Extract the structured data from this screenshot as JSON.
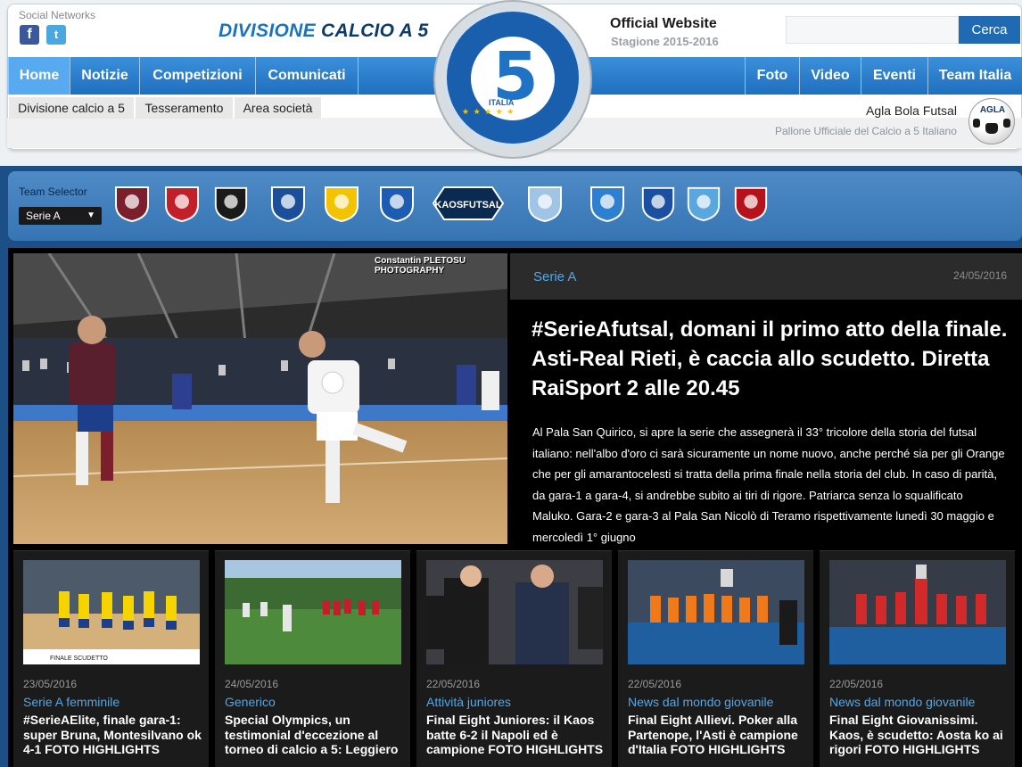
{
  "header": {
    "social_label": "Social Networks",
    "title_accent": "DIVISIONE",
    "title_rest": " CALCIO A 5",
    "official": "Official Website",
    "season": "Stagione 2015-2016",
    "search_placeholder": "",
    "search_button": "Cerca",
    "logo_text": "ITALIA",
    "logo_stars": "★ ★ ★ ★ ★",
    "logo_digit": "5",
    "sponsor_name": "Agla Bola Futsal",
    "sponsor_sub": "Pallone Ufficiale del Calcio a 5 Italiano",
    "sponsor_badge": "AGLA"
  },
  "social": {
    "facebook": "f",
    "twitter": "t"
  },
  "nav": {
    "left": [
      "Home",
      "Notizie",
      "Competizioni",
      "Comunicati"
    ],
    "right": [
      "Foto",
      "Video",
      "Eventi",
      "Team Italia"
    ],
    "active": "Home"
  },
  "subnav": [
    "Divisione calcio a 5",
    "Tesseramento",
    "Area società"
  ],
  "team_selector": {
    "label": "Team Selector",
    "selected": "Serie A",
    "kaos_label": "KAOSFUTSAL",
    "crest_colors": [
      "#7a1f2b",
      "#c21f2a",
      "#1a1a1a",
      "#1b4f9a",
      "#f2c300",
      "#1d5cb0",
      "#0b2a52",
      "#9fc4e6",
      "#2d7fd0",
      "#1b4fa0",
      "#5aa6df",
      "#b5121b"
    ]
  },
  "hero": {
    "photo_credit": "Constantin PLETOSU PHOTOGRAPHY",
    "category": "Serie A",
    "date": "24/05/2016",
    "title": "#SerieAfutsal, domani il primo atto della finale. Asti-Real Rieti, è caccia allo scudetto. Diretta RaiSport 2 alle 20.45",
    "text": "Al Pala San Quirico, si apre la serie che assegnerà il 33° tricolore della storia del futsal italiano: nell'albo d'oro ci sarà sicuramente un nome nuovo, anche perché sia per gli Orange che per gli amarantocelesti si tratta della prima finale nella storia del club. In caso di parità, da gara-1 a gara-4, si andrebbe subito ai tiri di rigore. Patriarca senza lo squalificato Maluko. Gara-2 e gara-3 al Pala San Nicolò di Teramo rispettivamente lunedì 30 maggio e mercoledì 1° giugno"
  },
  "cards": [
    {
      "date": "23/05/2016",
      "category": "Serie A femminile",
      "title": "#SerieAElite, finale gara-1: super Bruna, Montesilvano ok 4-1 FOTO HIGHLIGHTS",
      "banner": "FINALE SCUDETTO"
    },
    {
      "date": "24/05/2016",
      "category": "Generico",
      "title": "Special Olympics, un testimonial d'eccezione al torneo di calcio a 5: Leggiero"
    },
    {
      "date": "22/05/2016",
      "category": "Attività juniores",
      "title": "Final Eight Juniores: il Kaos batte 6-2 il Napoli ed è campione FOTO HIGHLIGHTS"
    },
    {
      "date": "22/05/2016",
      "category": "News dal mondo giovanile",
      "title": "Final Eight Allievi. Poker alla Partenope, l'Asti è campione d'Italia FOTO HIGHLIGHTS"
    },
    {
      "date": "22/05/2016",
      "category": "News dal mondo giovanile",
      "title": "Final Eight Giovanissimi. Kaos, è scudetto: Aosta ko ai rigori FOTO HIGHLIGHTS"
    }
  ]
}
